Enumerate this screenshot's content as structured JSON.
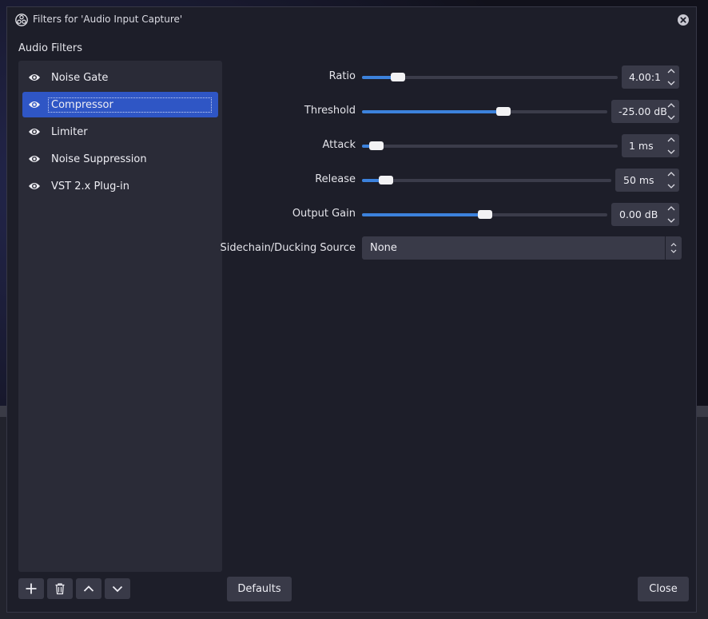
{
  "window": {
    "title": "Filters for 'Audio Input Capture'",
    "logo_icon": "obs-logo-icon",
    "close_icon": "close-icon"
  },
  "filters": {
    "section_label": "Audio Filters",
    "items": [
      {
        "label": "Noise Gate",
        "visible": true,
        "selected": false
      },
      {
        "label": "Compressor",
        "visible": true,
        "selected": true
      },
      {
        "label": "Limiter",
        "visible": true,
        "selected": false
      },
      {
        "label": "Noise Suppression",
        "visible": true,
        "selected": false
      },
      {
        "label": "VST 2.x Plug-in",
        "visible": true,
        "selected": false
      }
    ]
  },
  "properties": {
    "ratio": {
      "label": "Ratio",
      "value": "4.00:1",
      "slider_fraction": 0.12
    },
    "threshold": {
      "label": "Threshold",
      "value": "-25.00 dB",
      "slider_fraction": 0.58
    },
    "attack": {
      "label": "Attack",
      "value": "1 ms",
      "slider_fraction": 0.03
    },
    "release": {
      "label": "Release",
      "value": "50 ms",
      "slider_fraction": 0.07
    },
    "output_gain": {
      "label": "Output Gain",
      "value": "0.00 dB",
      "slider_fraction": 0.5
    },
    "sidechain": {
      "label": "Sidechain/Ducking Source",
      "value": "None"
    }
  },
  "toolbar": {
    "add_icon": "plus-icon",
    "remove_icon": "trash-icon",
    "move_up_icon": "chevron-up-icon",
    "move_down_icon": "chevron-down-icon"
  },
  "buttons": {
    "defaults_label": "Defaults",
    "close_label": "Close"
  },
  "colors": {
    "accent": "#3c82dc",
    "selection": "#2f56c5",
    "window_bg": "#1d1e29",
    "panel_bg": "#2a2b37",
    "control_bg": "#393a48"
  }
}
